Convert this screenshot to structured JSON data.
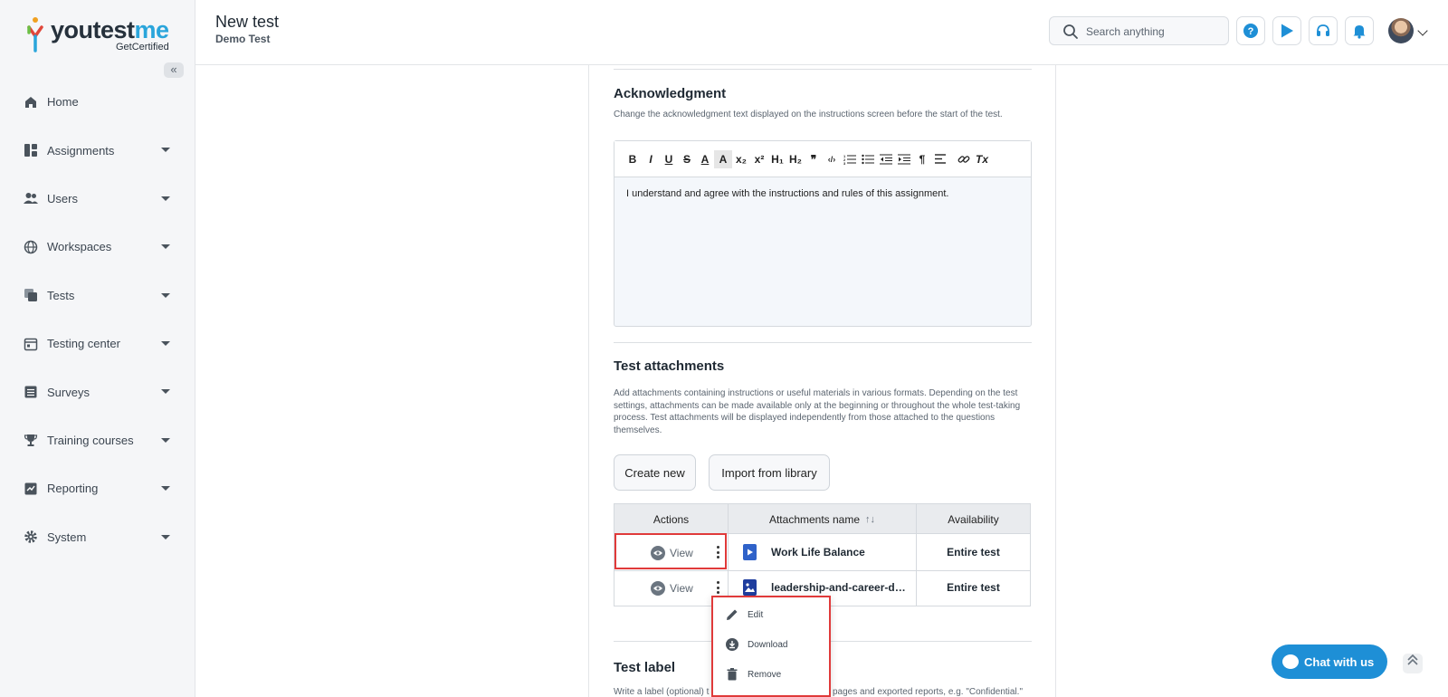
{
  "brand": {
    "name_part1": "youtest",
    "name_part2": "me",
    "sub": "GetCertified",
    "collapse_glyph": "«"
  },
  "sidebar": {
    "items": [
      {
        "label": "Home",
        "icon": "home-icon",
        "has_caret": false
      },
      {
        "label": "Assignments",
        "icon": "dashboard-icon",
        "has_caret": true
      },
      {
        "label": "Users",
        "icon": "users-icon",
        "has_caret": true
      },
      {
        "label": "Workspaces",
        "icon": "globe-icon",
        "has_caret": true
      },
      {
        "label": "Tests",
        "icon": "tests-icon",
        "has_caret": true
      },
      {
        "label": "Testing center",
        "icon": "calendar-icon",
        "has_caret": true
      },
      {
        "label": "Surveys",
        "icon": "list-icon",
        "has_caret": true
      },
      {
        "label": "Training courses",
        "icon": "trophy-icon",
        "has_caret": true
      },
      {
        "label": "Reporting",
        "icon": "report-icon",
        "has_caret": true
      },
      {
        "label": "System",
        "icon": "gear-icon",
        "has_caret": true
      }
    ]
  },
  "header": {
    "title": "New test",
    "subtitle": "Demo Test",
    "search_placeholder": "Search anything",
    "buttons": [
      "help-icon",
      "play-icon",
      "headset-icon",
      "bell-icon"
    ]
  },
  "acknowledgment": {
    "title": "Acknowledgment",
    "description": "Change the acknowledgment text displayed on the instructions screen before the start of the test.",
    "editor_text": "I understand and agree with the instructions and rules of this assignment.",
    "toolbar": [
      "B",
      "I",
      "U",
      "S",
      "A",
      "A",
      "x₂",
      "x²",
      "H₁",
      "H₂",
      "❞",
      "‹/›",
      "ol",
      "ul",
      "outdent",
      "indent",
      "¶",
      "align",
      "link",
      "Tx"
    ]
  },
  "attachments": {
    "title": "Test attachments",
    "description": "Add attachments containing instructions or useful materials in various formats. Depending on the test settings, attachments can be made available only at the beginning or throughout the whole test-taking process. Test attachments will be displayed independently from those attached to the questions themselves.",
    "create_label": "Create new",
    "import_label": "Import from library",
    "columns": {
      "actions": "Actions",
      "name": "Attachments name",
      "sort_glyph": "↑↓",
      "availability": "Availability"
    },
    "rows": [
      {
        "view": "View",
        "name": "Work Life Balance",
        "file_icon": "video-file-icon",
        "availability": "Entire test"
      },
      {
        "view": "View",
        "name": "leadership-and-career-d…",
        "file_icon": "image-file-icon",
        "availability": "Entire test"
      }
    ]
  },
  "context_menu": {
    "items": [
      {
        "label": "Edit",
        "icon": "pencil-icon"
      },
      {
        "label": "Download",
        "icon": "download-icon"
      },
      {
        "label": "Remove",
        "icon": "trash-icon"
      }
    ]
  },
  "test_label": {
    "title": "Test label",
    "description_left": "Write a label (optional) t",
    "description_right": "pages and exported reports, e.g. \"Confidential.\""
  },
  "chat": {
    "label": "Chat with us"
  },
  "colors": {
    "accent": "#1e8fd6",
    "highlight": "#e03a3a",
    "sidebar_bg": "#f5f6f8"
  }
}
